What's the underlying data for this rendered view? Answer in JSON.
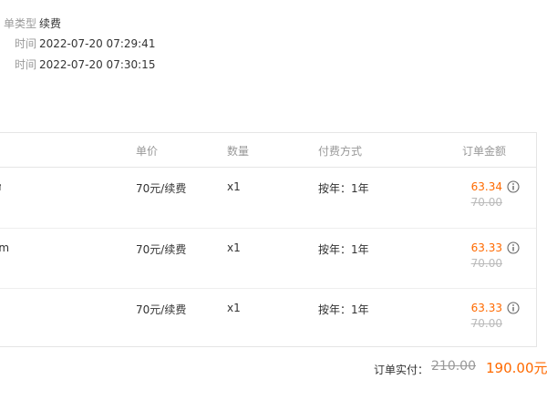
{
  "info": [
    {
      "label": "单类型",
      "value": "续费"
    },
    {
      "label": "时间",
      "value": "2022-07-20 07:29:41"
    },
    {
      "label": "时间",
      "value": "2022-07-20 07:30:15"
    }
  ],
  "table": {
    "headers": {
      "unit_price": "单价",
      "quantity": "数量",
      "payment": "付费方式",
      "amount": "订单金额"
    },
    "rows": [
      {
        "product": "m",
        "unit_price": "70元/续费",
        "quantity": "x1",
        "payment": "按年：1年",
        "price": "63.34",
        "original": "70.00"
      },
      {
        "product": "om",
        "unit_price": "70元/续费",
        "quantity": "x1",
        "payment": "按年：1年",
        "price": "63.33",
        "original": "70.00"
      },
      {
        "product": "",
        "unit_price": "70元/续费",
        "quantity": "x1",
        "payment": "按年：1年",
        "price": "63.33",
        "original": "70.00"
      }
    ]
  },
  "totals": {
    "label": "订单实付：",
    "original": "210.00",
    "final": "190.00元"
  },
  "colors": {
    "accent": "#ff6a00",
    "muted": "#999999",
    "border": "#e5e5e5"
  }
}
